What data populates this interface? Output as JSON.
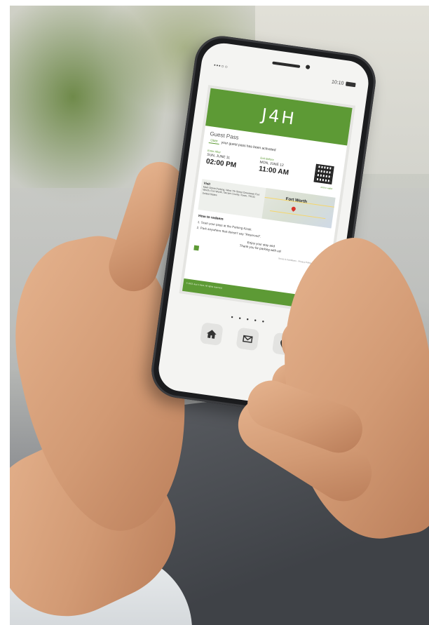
{
  "phone": {
    "status_time": "10:10",
    "status_signal": "•••○○"
  },
  "email": {
    "brand": "J4H",
    "pass_title": "Guest Pass",
    "user_name": "User",
    "activation_text": "your guest pass has been activated",
    "enter": {
      "label": "Enter After",
      "date": "SUN, JUNE 11",
      "time": "02:00 PM"
    },
    "exit": {
      "label": "Exit Before",
      "date": "MON, JUNE 12",
      "time": "11:00 AM"
    },
    "qr_link": "Add to wallet",
    "venue": {
      "title": "Visit",
      "address": "Main Street Parking, West 7th Street Downtown Fort Worth, Fort Worth, Tarrant County, Texas, 76102, United States"
    },
    "map_label": "Fort Worth",
    "redeem": {
      "title": "How to redeem",
      "steps": [
        "1. Scan your pass at the Parking Kiosk.",
        "2. Park anywhere that doesn't say \"Reserved\"."
      ]
    },
    "thanks": [
      "Enjoy your stay and",
      "Thank you for parking with us!"
    ],
    "footer_links": "Terms & Conditions · Privacy Policy · Unsubscribe",
    "footer_copy": "© 2023 Just 4 Here. All rights reserved."
  },
  "page_dots": "•••••",
  "dock": [
    {
      "name": "home",
      "icon": "home-icon"
    },
    {
      "name": "mail",
      "icon": "mail-icon"
    },
    {
      "name": "location",
      "icon": "location-pin-icon"
    }
  ]
}
